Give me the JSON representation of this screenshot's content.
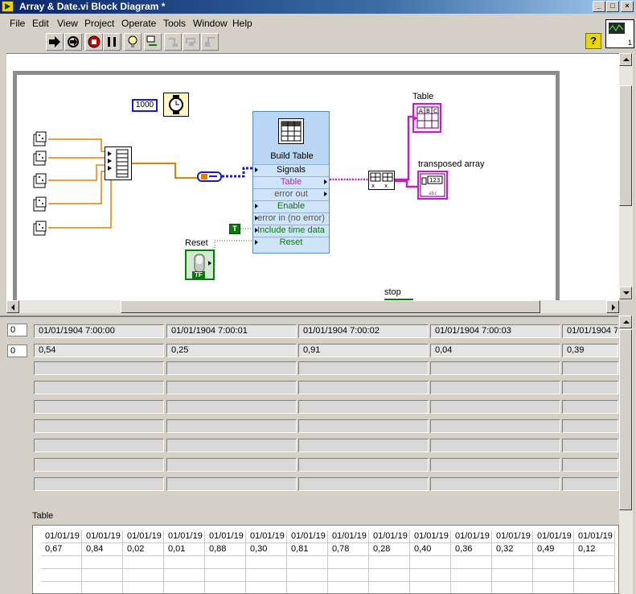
{
  "window": {
    "title": "Array & Date.vi Block Diagram *"
  },
  "menu": [
    "File",
    "Edit",
    "View",
    "Project",
    "Operate",
    "Tools",
    "Window",
    "Help"
  ],
  "toolbar": {
    "buttons": [
      "run-arrow-icon",
      "run-continuously-icon",
      "abort-icon",
      "pause-icon",
      "highlight-execution-icon",
      "retain-wire-values-icon",
      "step-into-icon",
      "step-over-icon",
      "step-out-icon"
    ],
    "help": "?"
  },
  "vi_icon": {
    "number": "1"
  },
  "diagram": {
    "constant_1000": "1000",
    "express_vi": {
      "name": "Build Table",
      "terminals": [
        "Signals",
        "Table",
        "error out",
        "Enable",
        "error in (no error)",
        "Include time data",
        "Reset"
      ]
    },
    "true_const": "T",
    "labels": {
      "reset": "Reset",
      "table": "Table",
      "transposed": "transposed array",
      "stop": "stop"
    },
    "tf": "TF"
  },
  "array": {
    "index_row": "0",
    "index_col": "0",
    "header": [
      "01/01/1904 7:00:00",
      "01/01/1904 7:00:01",
      "01/01/1904 7:00:02",
      "01/01/1904 7:00:03",
      "01/01/1904 7"
    ],
    "values": [
      "0,54",
      "0,25",
      "0,91",
      "0,04",
      "0,39"
    ]
  },
  "table": {
    "label": "Table",
    "header": [
      "01/01/19",
      "01/01/19",
      "01/01/19",
      "01/01/19",
      "01/01/19",
      "01/01/19",
      "01/01/19",
      "01/01/19",
      "01/01/19",
      "01/01/19",
      "01/01/19",
      "01/01/19",
      "01/01/19",
      "01/01/19"
    ],
    "values": [
      "0,67",
      "0,84",
      "0,02",
      "0,01",
      "0,88",
      "0,30",
      "0,81",
      "0,78",
      "0,28",
      "0,40",
      "0,36",
      "0,32",
      "0,49",
      "0,12"
    ]
  },
  "colors": {
    "title_bar": "#0a246a",
    "bool_wire": "#0b7a0b",
    "string_wire": "#c020c0",
    "numeric_wire": "#e08000",
    "dynamic_wire": "#1a1acc"
  }
}
